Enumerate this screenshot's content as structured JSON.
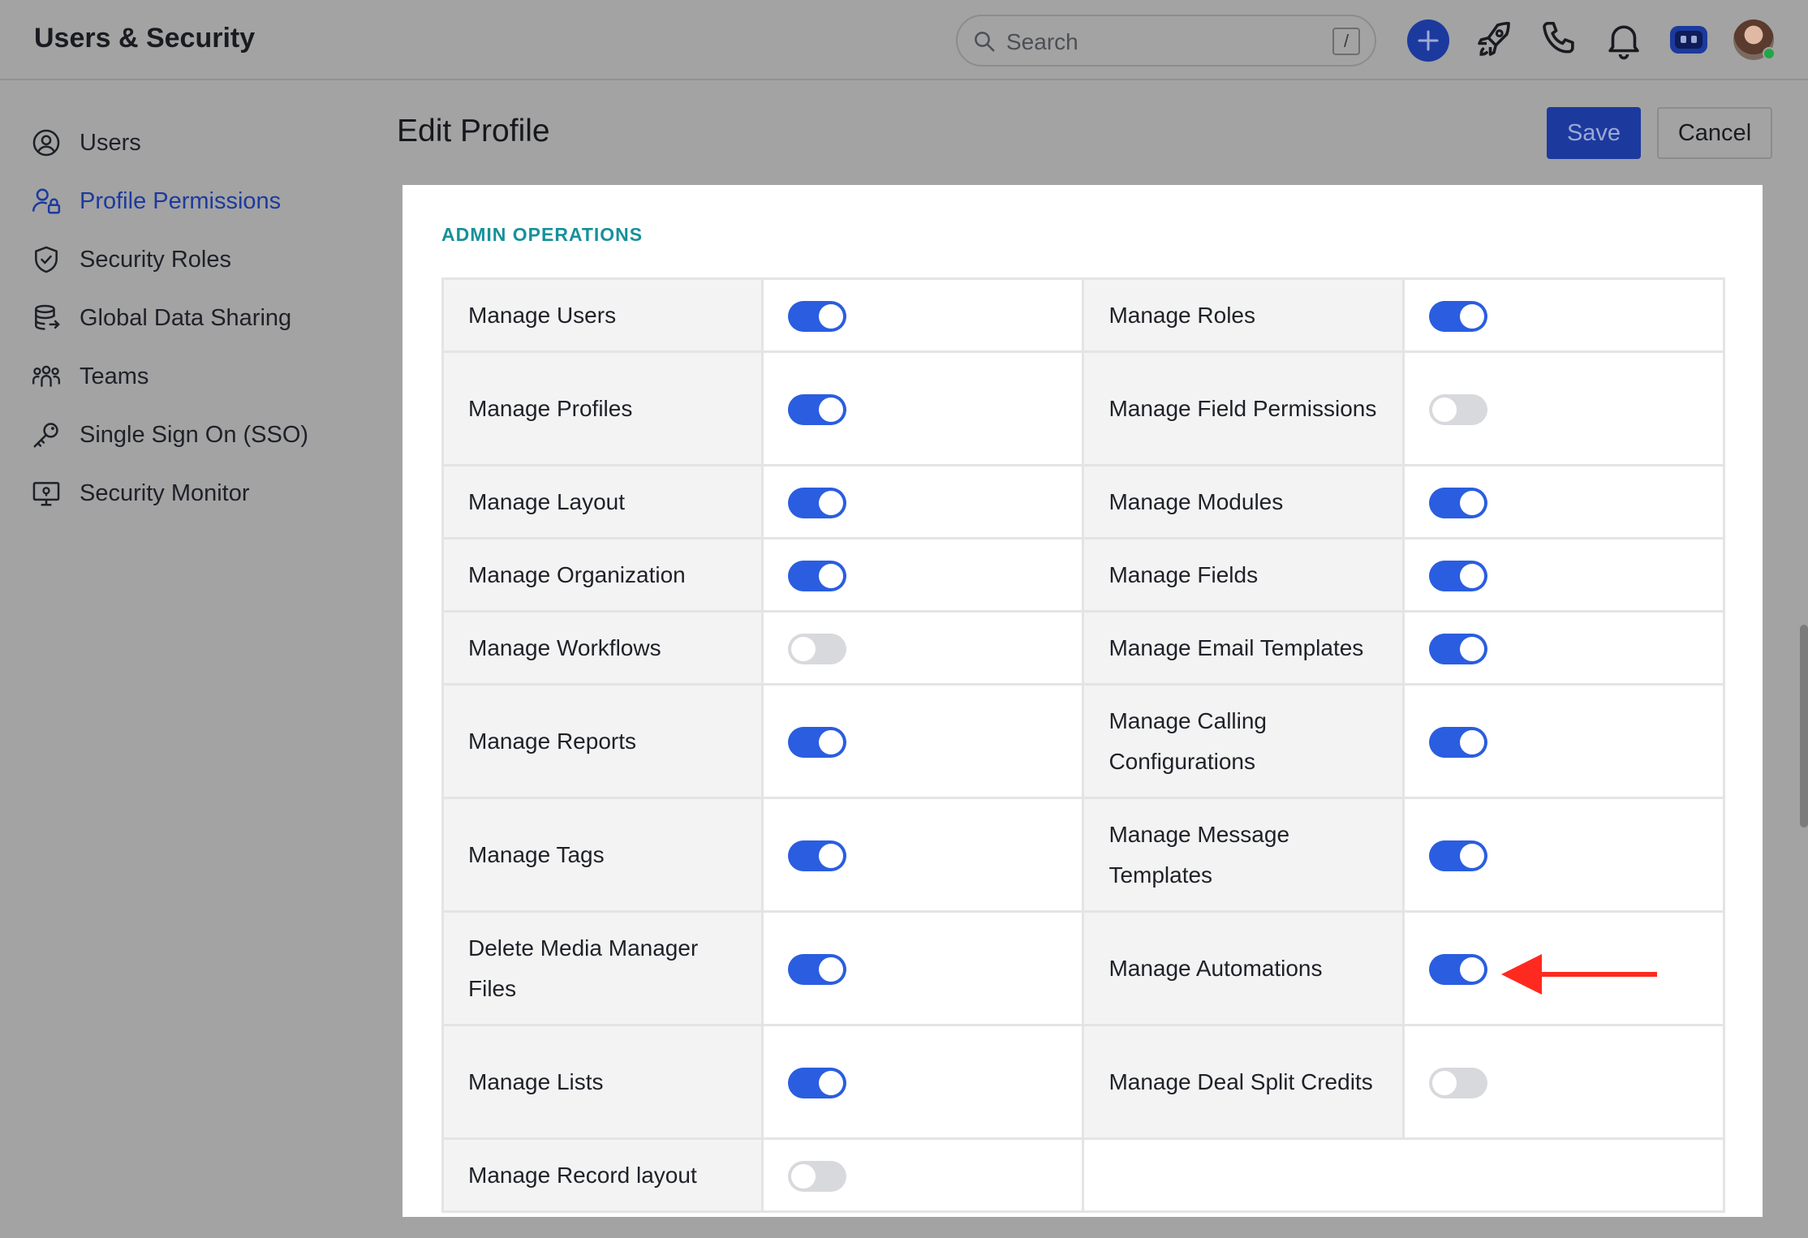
{
  "app": {
    "title": "Users & Security"
  },
  "search": {
    "placeholder": "Search",
    "shortcut": "/"
  },
  "topbar_icons": [
    "plus-icon",
    "rocket-icon",
    "phone-icon",
    "bell-icon",
    "assistant-icon",
    "avatar"
  ],
  "sidebar": {
    "items": [
      {
        "label": "Users",
        "icon": "user-circle-icon",
        "active": false
      },
      {
        "label": "Profile Permissions",
        "icon": "user-lock-icon",
        "active": true
      },
      {
        "label": "Security Roles",
        "icon": "shield-icon",
        "active": false
      },
      {
        "label": "Global Data Sharing",
        "icon": "database-icon",
        "active": false
      },
      {
        "label": "Teams",
        "icon": "team-icon",
        "active": false
      },
      {
        "label": "Single Sign On (SSO)",
        "icon": "key-icon",
        "active": false
      },
      {
        "label": "Security Monitor",
        "icon": "monitor-icon",
        "active": false
      }
    ]
  },
  "header": {
    "title": "Edit Profile",
    "save_label": "Save",
    "cancel_label": "Cancel"
  },
  "section": {
    "title": "ADMIN OPERATIONS"
  },
  "rows": [
    {
      "left": {
        "label": "Manage Users",
        "on": true
      },
      "right": {
        "label": "Manage Roles",
        "on": true
      }
    },
    {
      "left": {
        "label": "Manage Profiles",
        "on": true
      },
      "right": {
        "label": "Manage Field Permissions",
        "on": false
      }
    },
    {
      "left": {
        "label": "Manage Layout",
        "on": true
      },
      "right": {
        "label": "Manage Modules",
        "on": true
      }
    },
    {
      "left": {
        "label": "Manage Organization",
        "on": true
      },
      "right": {
        "label": "Manage Fields",
        "on": true
      }
    },
    {
      "left": {
        "label": "Manage Workflows",
        "on": false
      },
      "right": {
        "label": "Manage Email Templates",
        "on": true
      }
    },
    {
      "left": {
        "label": "Manage Reports",
        "on": true
      },
      "right": {
        "label": "Manage Calling Configurations",
        "on": true
      }
    },
    {
      "left": {
        "label": "Manage Tags",
        "on": true
      },
      "right": {
        "label": "Manage Message Templates",
        "on": true
      }
    },
    {
      "left": {
        "label": "Delete Media Manager Files",
        "on": true
      },
      "right": {
        "label": "Manage Automations",
        "on": true
      }
    },
    {
      "left": {
        "label": "Manage Lists",
        "on": true
      },
      "right": {
        "label": "Manage Deal Split Credits",
        "on": false
      }
    },
    {
      "left": {
        "label": "Manage Record layout",
        "on": false
      },
      "right": null
    }
  ],
  "colors": {
    "accent": "#1c3a9e",
    "toggle_on": "#2a5de0",
    "section": "#16919a",
    "annotation": "#ff2a1f"
  }
}
